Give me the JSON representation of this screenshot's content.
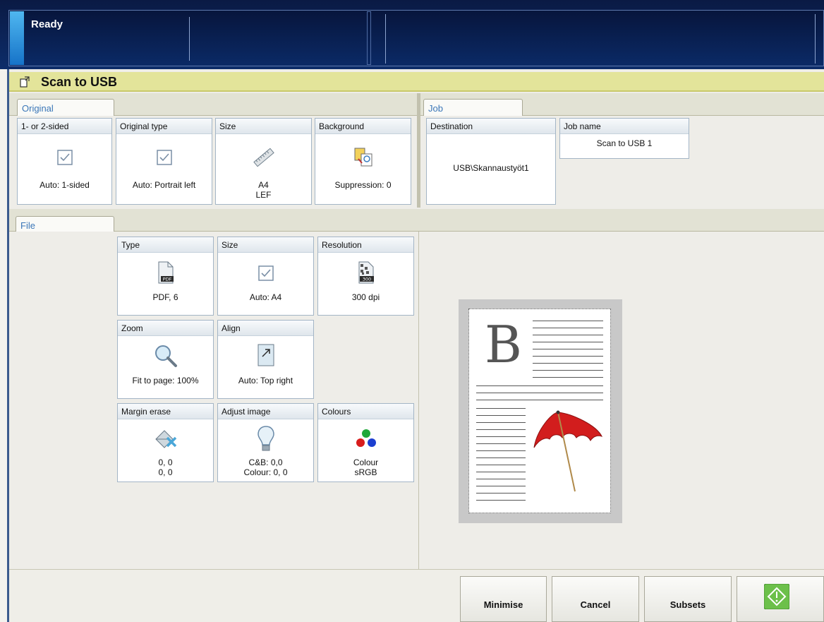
{
  "status": {
    "text": "Ready"
  },
  "title": "Scan to USB",
  "original": {
    "tab": "Original",
    "cards": [
      {
        "label": "1- or 2-sided",
        "value": "Auto: 1-sided",
        "icon": "checkbox-icon"
      },
      {
        "label": "Original type",
        "value": "Auto: Portrait left",
        "icon": "checkbox-icon"
      },
      {
        "label": "Size",
        "value1": "A4",
        "value2": "LEF",
        "icon": "ruler-icon"
      },
      {
        "label": "Background",
        "value": "Suppression: 0",
        "icon": "background-suppression-icon"
      }
    ]
  },
  "job": {
    "tab": "Job",
    "destination": {
      "label": "Destination",
      "value": "USB\\Skannaustyöt1"
    },
    "jobname": {
      "label": "Job name",
      "value": "Scan to USB 1"
    }
  },
  "file": {
    "tab": "File",
    "type": {
      "label": "Type",
      "value": "PDF, 6",
      "icon_text": "PDF"
    },
    "size": {
      "label": "Size",
      "value": "Auto: A4"
    },
    "resolution": {
      "label": "Resolution",
      "value": "300 dpi",
      "icon_text": "300"
    },
    "zoom": {
      "label": "Zoom",
      "value": "Fit to page: 100%"
    },
    "align": {
      "label": "Align",
      "value": "Auto: Top right"
    },
    "margin": {
      "label": "Margin erase",
      "value1": "0, 0",
      "value2": "0, 0"
    },
    "adjust": {
      "label": "Adjust image",
      "value1": "C&B: 0,0",
      "value2": "Colour: 0, 0"
    },
    "colours": {
      "label": "Colours",
      "value1": "Colour",
      "value2": "sRGB"
    }
  },
  "preview": {
    "letter": "B"
  },
  "buttons": {
    "minimise": "Minimise",
    "cancel": "Cancel",
    "subsets": "Subsets"
  },
  "colors": {
    "accent": "#3a76b8",
    "titlebar": "#e3e49a",
    "start": "#6cc04a"
  }
}
